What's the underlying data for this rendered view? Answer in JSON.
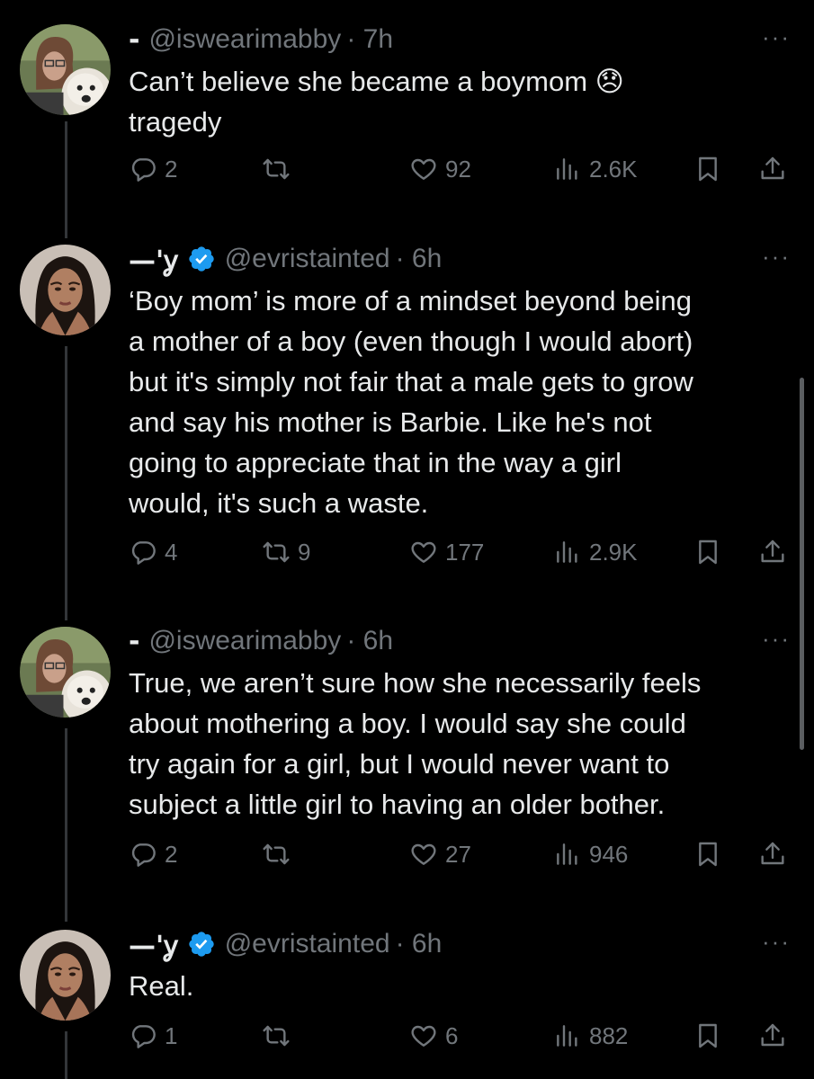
{
  "colors": {
    "background": "#000000",
    "text": "#e7e9ea",
    "muted": "#71767b",
    "verified": "#1d9bf0",
    "thread_line": "#333639"
  },
  "tweets": [
    {
      "name": "-",
      "handle": "@iswearimabby",
      "time": "· 7h",
      "verified": false,
      "avatar": "avatar-woman-with-dog",
      "lines": [
        "Can’t believe she became a boymom 😞",
        "tragedy"
      ],
      "more": "···",
      "replies": "2",
      "reposts": "",
      "likes": "92",
      "views": "2.6K"
    },
    {
      "name": "—'ỿ",
      "handle": "@evristainted",
      "time": "· 6h",
      "verified": true,
      "avatar": "avatar-woman-portrait",
      "lines": [
        "‘Boy mom’ is more of a mindset beyond being",
        "a mother of a boy (even though I would abort)",
        "but it's simply not fair that a male gets to grow",
        "and say his mother is Barbie. Like he's not",
        "going to appreciate that in the way a girl",
        "would, it's such a waste."
      ],
      "more": "···",
      "replies": "4",
      "reposts": "9",
      "likes": "177",
      "views": "2.9K"
    },
    {
      "name": "-",
      "handle": "@iswearimabby",
      "time": "· 6h",
      "verified": false,
      "avatar": "avatar-woman-with-dog",
      "lines": [
        "True, we aren’t sure how she necessarily feels",
        "about mothering a boy. I would say she could",
        "try again for a girl, but I would never want to",
        "subject a little girl to having an older bother."
      ],
      "more": "···",
      "replies": "2",
      "reposts": "",
      "likes": "27",
      "views": "946"
    },
    {
      "name": "—'ỿ",
      "handle": "@evristainted",
      "time": "· 6h",
      "verified": true,
      "avatar": "avatar-woman-portrait",
      "lines": [
        "Real."
      ],
      "more": "···",
      "replies": "1",
      "reposts": "",
      "likes": "6",
      "views": "882"
    }
  ]
}
